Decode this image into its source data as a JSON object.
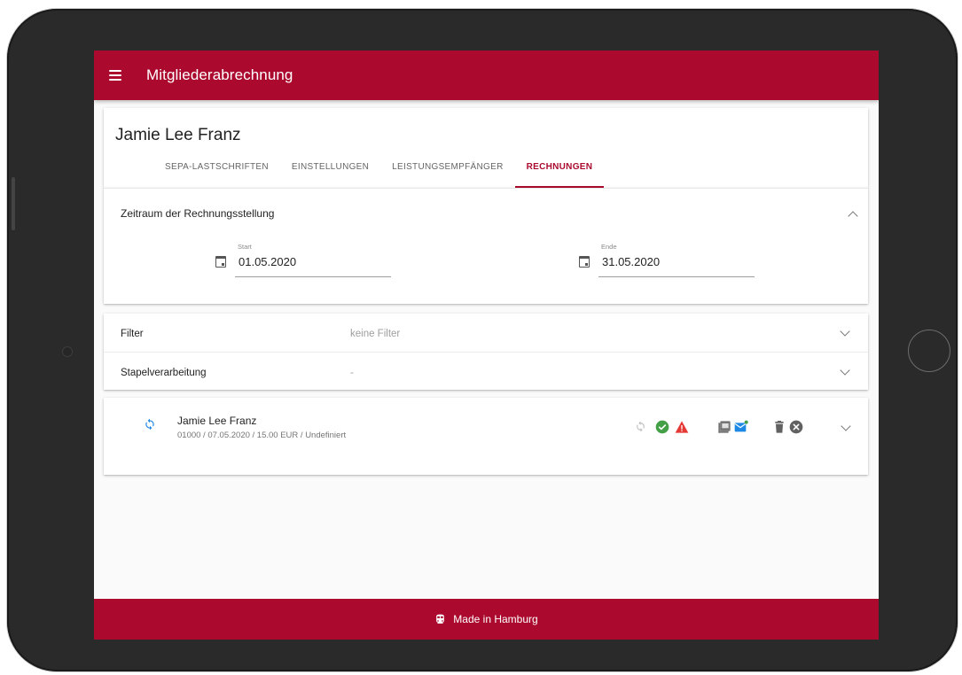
{
  "app": {
    "title": "Mitgliederabrechnung"
  },
  "member": {
    "name": "Jamie Lee Franz"
  },
  "tabs": [
    {
      "label": "SEPA-LASTSCHRIFTEN",
      "active": false
    },
    {
      "label": "EINSTELLUNGEN",
      "active": false
    },
    {
      "label": "LEISTUNGSEMPFÄNGER",
      "active": false
    },
    {
      "label": "RECHNUNGEN",
      "active": true
    }
  ],
  "period": {
    "title": "Zeitraum der Rechnungsstellung",
    "start_label": "Start",
    "start_value": "01.05.2020",
    "end_label": "Ende",
    "end_value": "31.05.2020"
  },
  "filter": {
    "label": "Filter",
    "value": "keine Filter"
  },
  "batch": {
    "label": "Stapelverarbeitung",
    "value": "-"
  },
  "invoice": {
    "name": "Jamie Lee Franz",
    "details": "01000 / 07.05.2020 / 15.00 EUR / Undefiniert"
  },
  "footer": {
    "text": "Made in Hamburg"
  },
  "colors": {
    "brand": "#ab0a2e",
    "success": "#43a047",
    "warning": "#e53935",
    "info": "#1e88e5"
  },
  "icons": {
    "menu": "menu-icon",
    "calendar": "calendar-icon",
    "sync": "sync-icon",
    "check": "check-circle-icon",
    "warning": "warning-icon",
    "pdf": "pdf-icon",
    "mail": "mail-icon",
    "delete": "delete-icon",
    "cancel": "cancel-icon",
    "train": "train-icon"
  }
}
